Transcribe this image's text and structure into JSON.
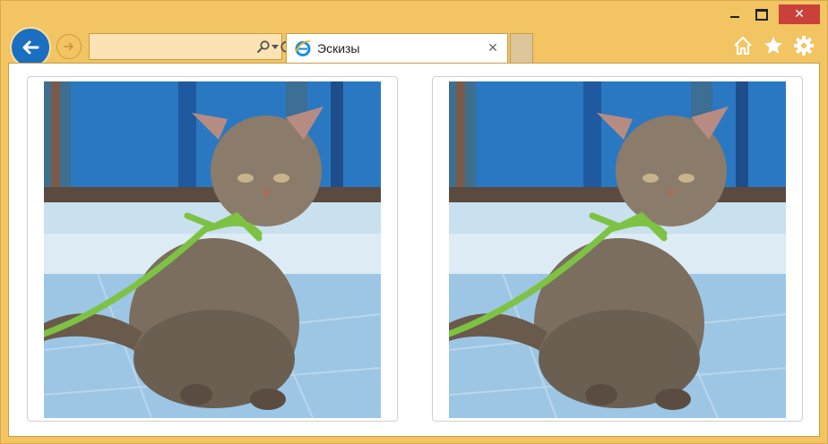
{
  "window": {
    "caption": {
      "minimize": "",
      "maximize": "",
      "close": "✕"
    }
  },
  "nav": {
    "address": {
      "value": "",
      "placeholder": ""
    }
  },
  "tabs": [
    {
      "title": "Эскизы",
      "close": "✕",
      "icon": "ie-logo-icon"
    }
  ],
  "toolbar": {
    "icons": [
      "home-icon",
      "favorites-star-icon",
      "settings-gear-icon"
    ]
  },
  "content": {
    "thumbnails": [
      {
        "subject": "kitten-with-ribbon",
        "icon": "image"
      },
      {
        "subject": "kitten-with-ribbon",
        "icon": "image"
      }
    ]
  },
  "colors": {
    "frame": "#f2c462",
    "back_button": "#1a6fc1",
    "close_button": "#c9413a",
    "ribbon": "#7dc243",
    "wall": "#2b78c2"
  }
}
